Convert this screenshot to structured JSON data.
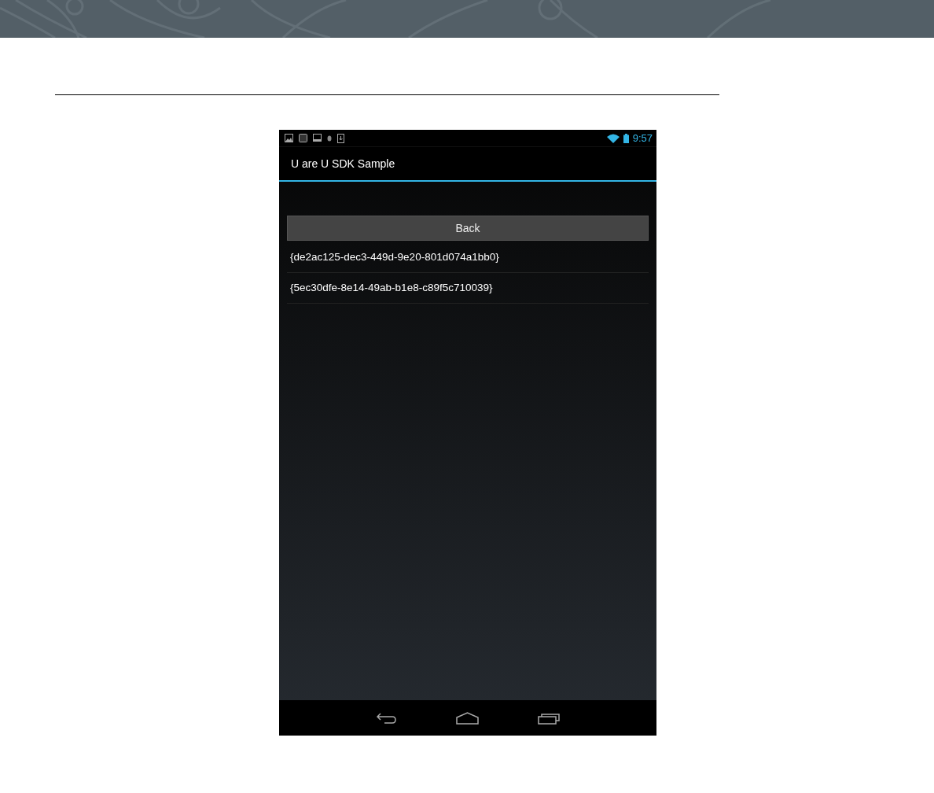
{
  "status_bar": {
    "time": "9:57"
  },
  "action_bar": {
    "title": "U are U SDK Sample"
  },
  "back_button": {
    "label": "Back"
  },
  "list": [
    {
      "text": "{de2ac125-dec3-449d-9e20-801d074a1bb0}"
    },
    {
      "text": "{5ec30dfe-8e14-49ab-b1e8-c89f5c710039}"
    }
  ]
}
